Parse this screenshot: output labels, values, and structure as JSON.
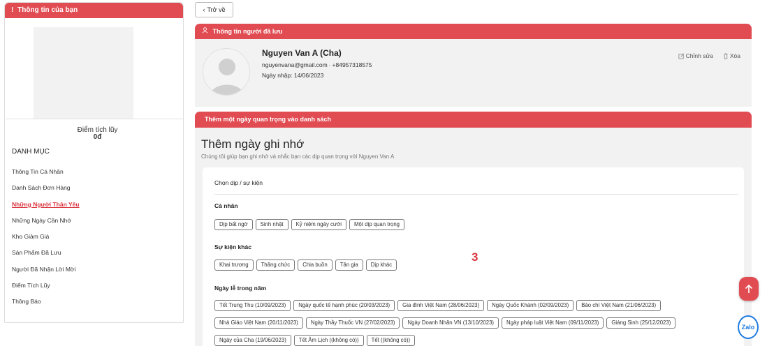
{
  "sidebar": {
    "header": "Thông tin của bạn",
    "points_label": "Điểm tích lũy",
    "points_value": "0đ",
    "section_title": "DANH MỤC",
    "items": [
      {
        "label": "Thông Tin Cá Nhân"
      },
      {
        "label": "Danh Sách Đơn Hàng"
      },
      {
        "label": "Những Người Thân Yêu",
        "active": true
      },
      {
        "label": "Những Ngày Cần Nhớ"
      },
      {
        "label": "Kho Giảm Giá"
      },
      {
        "label": "Sản Phẩm Đã Lưu"
      },
      {
        "label": "Người Đã Nhận Lời Mời"
      },
      {
        "label": "Điểm Tích Lũy"
      },
      {
        "label": "Thông Báo"
      }
    ]
  },
  "back_button": "Trở về",
  "saved_person": {
    "header": "Thông tin người đã lưu",
    "name": "Nguyen Van A (Cha)",
    "email": "nguyenvana@gmail.com",
    "phone": "+84957318575",
    "date": "Ngày nhập: 14/06/2023",
    "edit_label": "Chỉnh sửa",
    "delete_label": "Xóa"
  },
  "add_day": {
    "header": "Thêm một ngày quan trọng vào danh sách",
    "title": "Thêm ngày ghi nhớ",
    "subtitle": "Chúng tôi giúp bạn ghi nhớ và nhắc bạn các dịp quan trọng với Nguyen Van A",
    "choose_label": "Chọn dịp / sự kiện",
    "sections": [
      {
        "label": "Cá nhân",
        "chips": [
          "Dịp bất ngờ",
          "Sinh nhật",
          "Kỷ niệm ngày cưới",
          "Một dịp quan trọng"
        ]
      },
      {
        "label": "Sự kiện khác",
        "chips": [
          "Khai trương",
          "Thăng chức",
          "Chia buồn",
          "Tân gia",
          "Dịp khác"
        ]
      },
      {
        "label": "Ngày lễ trong năm",
        "chips": []
      }
    ],
    "holiday_rows": [
      [
        "Tết Trung Thu (10/09/2023)",
        "Ngày quốc tế hạnh phúc (20/03/2023)",
        "Gia đình Việt Nam (28/06/2023)",
        "Ngày Quốc Khánh (02/09/2023)",
        "Báo chí Việt Nam (21/06/2023)"
      ],
      [
        "Nhà Giáo Việt Nam (20/11/2023)",
        "Ngày Thầy Thuốc VN (27/02/2023)",
        "Ngày Doanh Nhân VN (13/10/2023)",
        "Ngày pháp luật Việt Nam (09/11/2023)",
        "Giáng Sinh (25/12/2023)"
      ],
      [
        "Ngày của Cha (19/06/2023)",
        "Tết Âm Lịch ((không có))",
        "Tết ((không có))"
      ]
    ]
  },
  "annotation": "3",
  "zalo_label": "Zalo",
  "colors": {
    "accent": "#e14b52",
    "active_link": "#d9343e",
    "zalo": "#1e7be0"
  }
}
